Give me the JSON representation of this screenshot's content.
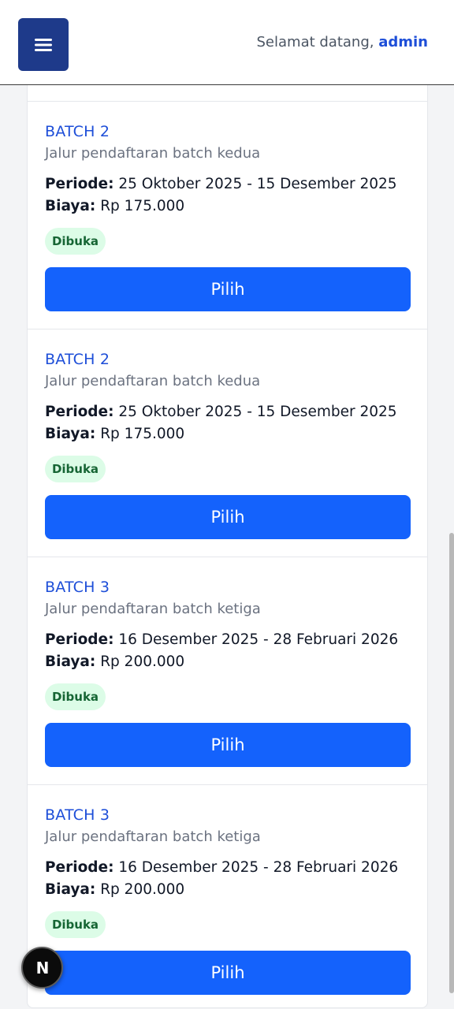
{
  "header": {
    "welcome_text": "Selamat datang,",
    "username": "admin",
    "menu_icon": "hamburger-icon"
  },
  "batches": [
    {
      "title": "BATCH 2",
      "description": "Jalur pendaftaran batch kedua",
      "periode_label": "Periode:",
      "periode_value": "25 Oktober 2025 - 15 Desember 2025",
      "biaya_label": "Biaya:",
      "biaya_value": "Rp 175.000",
      "status": "Dibuka",
      "button_label": "Pilih"
    },
    {
      "title": "BATCH 2",
      "description": "Jalur pendaftaran batch kedua",
      "periode_label": "Periode:",
      "periode_value": "25 Oktober 2025 - 15 Desember 2025",
      "biaya_label": "Biaya:",
      "biaya_value": "Rp 175.000",
      "status": "Dibuka",
      "button_label": "Pilih"
    },
    {
      "title": "BATCH 3",
      "description": "Jalur pendaftaran batch ketiga",
      "periode_label": "Periode:",
      "periode_value": "16 Desember 2025 - 28 Februari 2026",
      "biaya_label": "Biaya:",
      "biaya_value": "Rp 200.000",
      "status": "Dibuka",
      "button_label": "Pilih"
    },
    {
      "title": "BATCH 3",
      "description": "Jalur pendaftaran batch ketiga",
      "periode_label": "Periode:",
      "periode_value": "16 Desember 2025 - 28 Februari 2026",
      "biaya_label": "Biaya:",
      "biaya_value": "Rp 200.000",
      "status": "Dibuka",
      "button_label": "Pilih"
    }
  ],
  "floating_badge": {
    "letter": "N",
    "icon": "nextjs-logo-icon"
  },
  "colors": {
    "header_menu_bg": "#1e3a8a",
    "accent": "#1d4ed8",
    "button_bg": "#1462fc",
    "status_bg": "#dcfce7",
    "status_text": "#166534"
  }
}
